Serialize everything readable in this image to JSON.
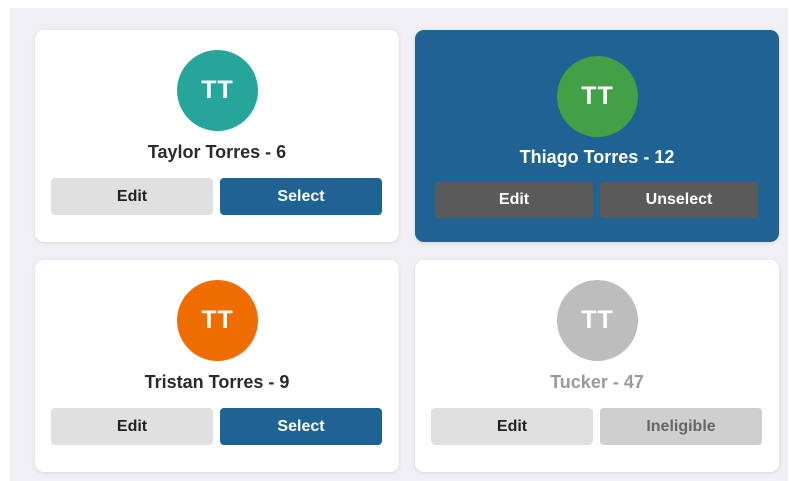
{
  "colors": {
    "board_background": "#f0f0f4",
    "card_background": "#ffffff",
    "selected_card_background": "#1e6394",
    "primary_button": "#1e6394",
    "edit_button": "#e0e0e0",
    "selected_buttons": "#5a5a5a",
    "disabled_button": "#cfcfcf",
    "ineligible_text": "#9a9a9a"
  },
  "cards": [
    {
      "initials": "TT",
      "avatar_color": "#26a69a",
      "label": "Taylor Torres - 6",
      "edit_label": "Edit",
      "action_label": "Select",
      "state": "unselected"
    },
    {
      "initials": "TT",
      "avatar_color": "#43a047",
      "label": "Thiago Torres - 12",
      "edit_label": "Edit",
      "action_label": "Unselect",
      "state": "selected"
    },
    {
      "initials": "TT",
      "avatar_color": "#ef6c00",
      "label": "Tristan Torres - 9",
      "edit_label": "Edit",
      "action_label": "Select",
      "state": "unselected"
    },
    {
      "initials": "TT",
      "avatar_color": "#bdbdbd",
      "label": "Tucker - 47",
      "edit_label": "Edit",
      "action_label": "Ineligible",
      "state": "ineligible"
    }
  ]
}
